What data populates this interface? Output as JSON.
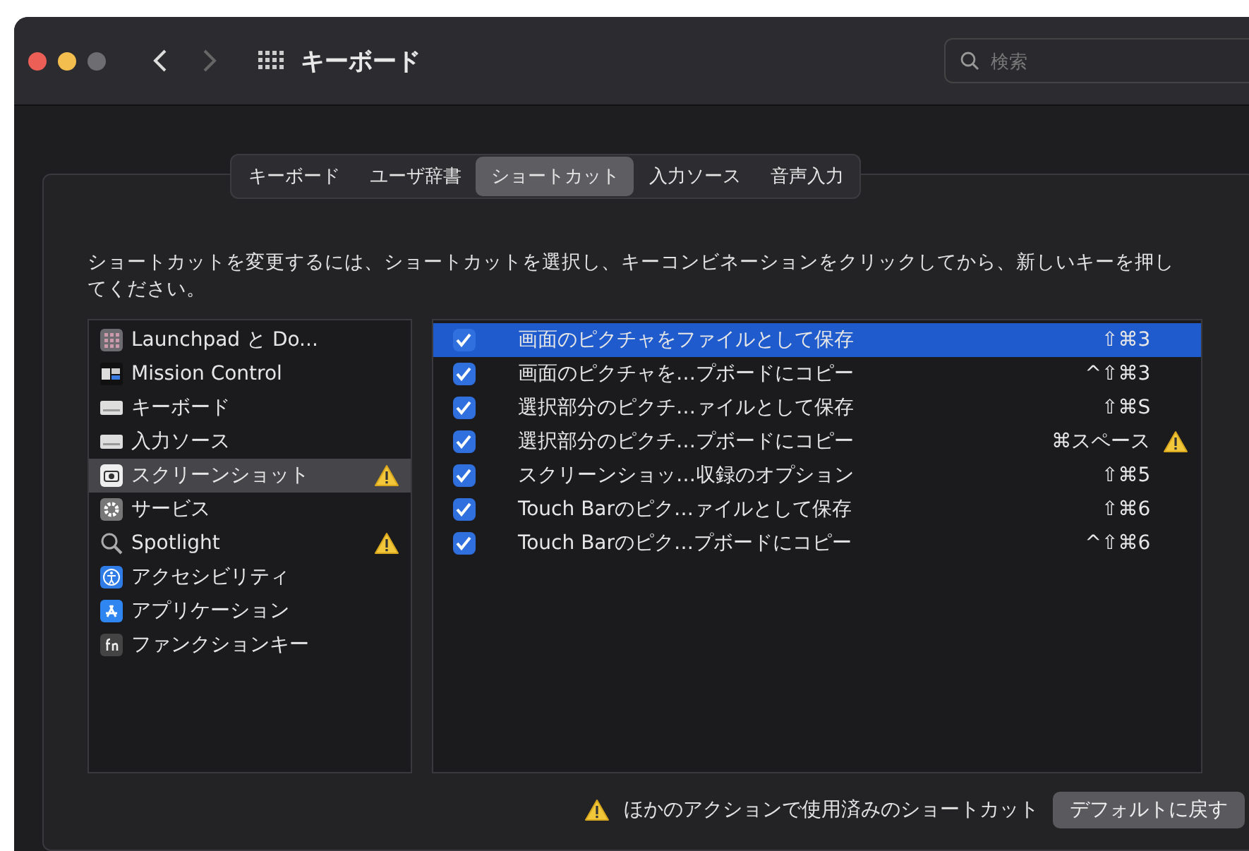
{
  "window": {
    "title": "キーボード",
    "search": {
      "placeholder": "検索"
    }
  },
  "tabs": [
    {
      "label": "キーボード",
      "selected": false
    },
    {
      "label": "ユーザ辞書",
      "selected": false
    },
    {
      "label": "ショートカット",
      "selected": true
    },
    {
      "label": "入力ソース",
      "selected": false
    },
    {
      "label": "音声入力",
      "selected": false
    }
  ],
  "description": "ショートカットを変更するには、ショートカットを選択し、キーコンビネーションをクリックしてから、新しいキーを押してください。",
  "sidebar": {
    "items": [
      {
        "label": "Launchpad と Do...",
        "selected": false,
        "warning": false
      },
      {
        "label": "Mission Control",
        "selected": false,
        "warning": false
      },
      {
        "label": "キーボード",
        "selected": false,
        "warning": false
      },
      {
        "label": "入力ソース",
        "selected": false,
        "warning": false
      },
      {
        "label": "スクリーンショット",
        "selected": true,
        "warning": true
      },
      {
        "label": "サービス",
        "selected": false,
        "warning": false
      },
      {
        "label": "Spotlight",
        "selected": false,
        "warning": true
      },
      {
        "label": "アクセシビリティ",
        "selected": false,
        "warning": false
      },
      {
        "label": "アプリケーション",
        "selected": false,
        "warning": false
      },
      {
        "label": "ファンクションキー",
        "selected": false,
        "warning": false
      }
    ]
  },
  "shortcuts": [
    {
      "action": "画面のピクチャをファイルとして保存",
      "keys": "⇧⌘3",
      "checked": true,
      "selected": true,
      "warning": false
    },
    {
      "action": "画面のピクチャを…プボードにコピー",
      "keys": "^⇧⌘3",
      "checked": true,
      "selected": false,
      "warning": false
    },
    {
      "action": "選択部分のピクチ…ァイルとして保存",
      "keys": "⇧⌘S",
      "checked": true,
      "selected": false,
      "warning": false
    },
    {
      "action": "選択部分のピクチ…プボードにコピー",
      "keys": "⌘スペース",
      "checked": true,
      "selected": false,
      "warning": true
    },
    {
      "action": "スクリーンショッ…収録のオプション",
      "keys": "⇧⌘5",
      "checked": true,
      "selected": false,
      "warning": false
    },
    {
      "action": "Touch Barのピク…ァイルとして保存",
      "keys": "⇧⌘6",
      "checked": true,
      "selected": false,
      "warning": false
    },
    {
      "action": "Touch Barのピク…プボードにコピー",
      "keys": "^⇧⌘6",
      "checked": true,
      "selected": false,
      "warning": false
    }
  ],
  "footer": {
    "legend": "ほかのアクションで使用済みのショートカット",
    "button": "デフォルトに戻す"
  }
}
